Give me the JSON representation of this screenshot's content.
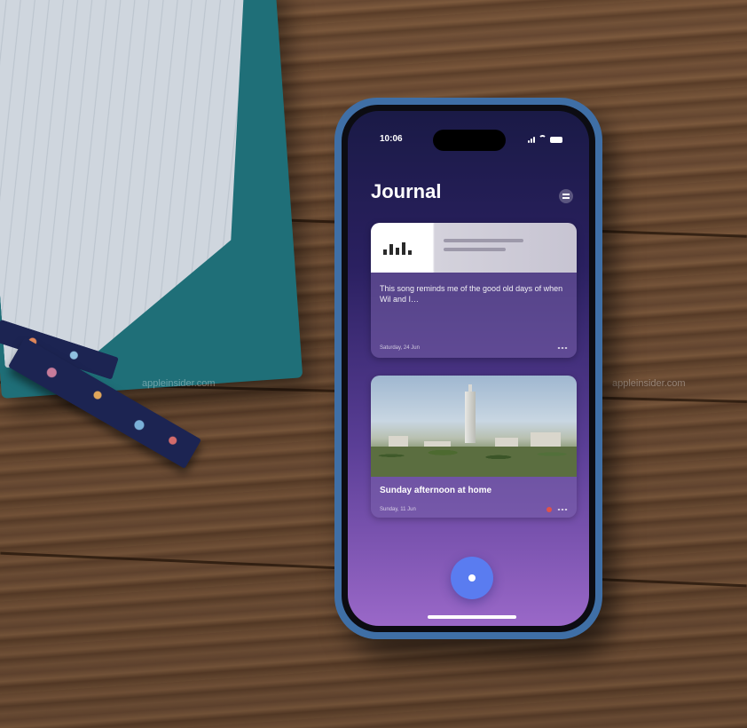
{
  "app": {
    "title": "Journal",
    "status_time": "10:06"
  },
  "cards": [
    {
      "type": "link",
      "text": "This song reminds me of the good old days of when Wil and I…",
      "date": "Saturday, 24 Jun"
    },
    {
      "type": "photo",
      "title": "Sunday afternoon at home",
      "date": "Sunday, 11 Jun"
    }
  ],
  "watermark": "appleinsider.com",
  "colors": {
    "phone_case": "#3f6fa6",
    "screen_top": "#1a1a46",
    "screen_bottom": "#9a68c8",
    "accent_button": "#5a7cf0"
  },
  "icons": [
    "menu-icon",
    "wifi-icon",
    "battery-icon",
    "signal-icon",
    "add-entry-icon",
    "more-icon",
    "favorite-icon"
  ]
}
